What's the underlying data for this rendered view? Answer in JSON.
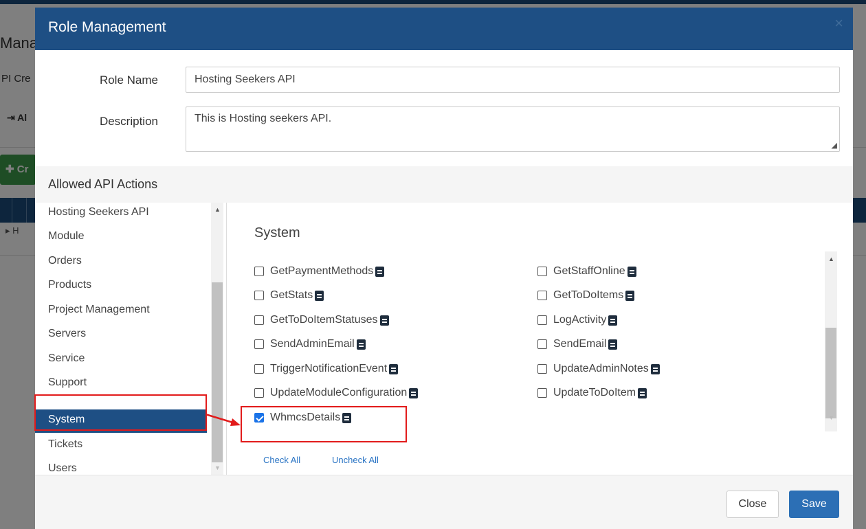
{
  "background": {
    "title": "Mana",
    "subtitle": "PI Cre",
    "link": "⇥ Al",
    "button": "✚ Cr",
    "row_marker": "▸  H"
  },
  "modal": {
    "title": "Role Management",
    "close_glyph": "×"
  },
  "form": {
    "role_name_label": "Role Name",
    "role_name_value": "Hosting Seekers API",
    "description_label": "Description",
    "description_value": "This is Hosting seekers API."
  },
  "allowed": {
    "title": "Allowed API Actions"
  },
  "categories": [
    {
      "label": "Hosting Seekers API",
      "active": false
    },
    {
      "label": "Module",
      "active": false
    },
    {
      "label": "Orders",
      "active": false
    },
    {
      "label": "Products",
      "active": false
    },
    {
      "label": "Project Management",
      "active": false
    },
    {
      "label": "Servers",
      "active": false
    },
    {
      "label": "Service",
      "active": false
    },
    {
      "label": "Support",
      "active": false
    },
    {
      "label": "System",
      "active": true
    },
    {
      "label": "Tickets",
      "active": false
    },
    {
      "label": "Users",
      "active": false
    }
  ],
  "actions_panel": {
    "title": "System",
    "check_all": "Check All",
    "uncheck_all": "Uncheck All"
  },
  "actions": [
    {
      "label": "GetPaymentMethods",
      "checked": false
    },
    {
      "label": "GetStaffOnline",
      "checked": false
    },
    {
      "label": "GetStats",
      "checked": false
    },
    {
      "label": "GetToDoItems",
      "checked": false
    },
    {
      "label": "GetToDoItemStatuses",
      "checked": false
    },
    {
      "label": "LogActivity",
      "checked": false
    },
    {
      "label": "SendAdminEmail",
      "checked": false
    },
    {
      "label": "SendEmail",
      "checked": false
    },
    {
      "label": "TriggerNotificationEvent",
      "checked": false
    },
    {
      "label": "UpdateAdminNotes",
      "checked": false
    },
    {
      "label": "UpdateModuleConfiguration",
      "checked": false
    },
    {
      "label": "UpdateToDoItem",
      "checked": false
    },
    {
      "label": "WhmcsDetails",
      "checked": true
    }
  ],
  "footer": {
    "close_label": "Close",
    "save_label": "Save"
  },
  "colors": {
    "header": "#1e4f84",
    "active_item": "#1e4f84",
    "annotation": "#e21b1b",
    "save_button": "#2c6fb5",
    "link": "#2a74c4"
  }
}
